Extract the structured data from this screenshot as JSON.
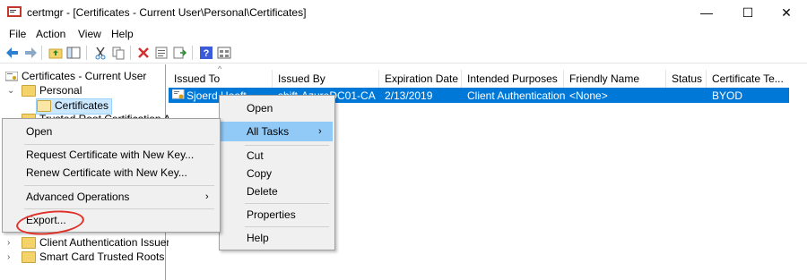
{
  "window": {
    "title": "certmgr - [Certificates - Current User\\Personal\\Certificates]",
    "minimize_glyph": "—",
    "maximize_glyph": "☐",
    "close_glyph": "✕"
  },
  "menubar": [
    "File",
    "Action",
    "View",
    "Help"
  ],
  "tree": {
    "root": "Certificates - Current User",
    "personal": "Personal",
    "certificates": "Certificates",
    "trusted_root_partial": "Trusted Root Certification Au",
    "client_auth_issuers": "Client Authentication Issuers",
    "smart_card_roots": "Smart Card Trusted Roots"
  },
  "columns": [
    "Issued To",
    "Issued By",
    "Expiration Date",
    "Intended Purposes",
    "Friendly Name",
    "Status",
    "Certificate Te..."
  ],
  "selected_row": {
    "issued_to": "Sjoerd Hooft",
    "issued_by": "shift-AzureDC01-CA",
    "expiration": "2/13/2019",
    "purposes": "Client Authentication",
    "friendly_name": "<None>",
    "status": "",
    "template": "BYOD"
  },
  "context_menu_main": {
    "open": "Open",
    "all_tasks": "All Tasks",
    "cut": "Cut",
    "copy": "Copy",
    "delete": "Delete",
    "properties": "Properties",
    "help": "Help"
  },
  "context_menu_tasks": {
    "open": "Open",
    "request_new_key": "Request Certificate with New Key...",
    "renew_new_key": "Renew Certificate with New Key...",
    "advanced_ops": "Advanced Operations",
    "export": "Export..."
  },
  "colors": {
    "selection": "#0078d7",
    "menu_highlight": "#91c9f7",
    "annotation_circle": "#e0302a"
  }
}
